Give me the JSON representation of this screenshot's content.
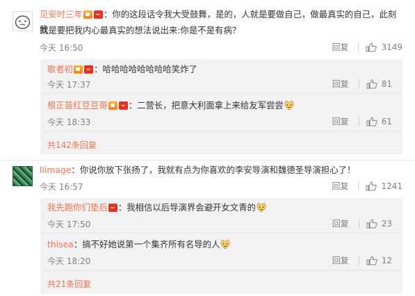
{
  "comments": [
    {
      "username": "见安时三年",
      "text_line1": "：你的这段话令我大受鼓舞，是的，人就是要做自己，做最真实的自己，此刻我",
      "text_line2": "就是要把我内心最真实的想法说出来:你是不是有病？",
      "time": "今天 16:50",
      "reply_label": "回复",
      "likes": "3149",
      "replies": [
        {
          "username": "歌者初",
          "text": "：哈哈哈哈哈哈哈哈笑炸了",
          "time": "今天 17:37",
          "reply_label": "回复",
          "likes": "81"
        },
        {
          "username": "根正苗红豆豆哥",
          "text": "：二营长，把意大利面拿上来给友军尝尝",
          "time": "今天 18:33",
          "reply_label": "回复",
          "likes": "61"
        }
      ],
      "more_replies": "共142条回复"
    },
    {
      "username": "llimage",
      "text_line1": "：你说你放下张扬了，我就有点为你喜欢的李安导演和魏德圣导演担心了！",
      "time": "今天 16:57",
      "reply_label": "回复",
      "likes": "1241",
      "replies": [
        {
          "username": "我先跑你们垫后",
          "text": "：我相信以后导演界会避开女文青的",
          "time": "今天 17:50",
          "reply_label": "回复",
          "likes": "23"
        },
        {
          "username": "thisea",
          "text": "：搞不好她说第一个集齐所有名导的人",
          "time": "今天 18:20",
          "reply_label": "回复",
          "likes": "12"
        }
      ],
      "more_replies": "共21条回复"
    }
  ],
  "colors": {
    "username": "#eb7350",
    "meta": "#808080",
    "reply_bg": "#f2f2f5"
  }
}
